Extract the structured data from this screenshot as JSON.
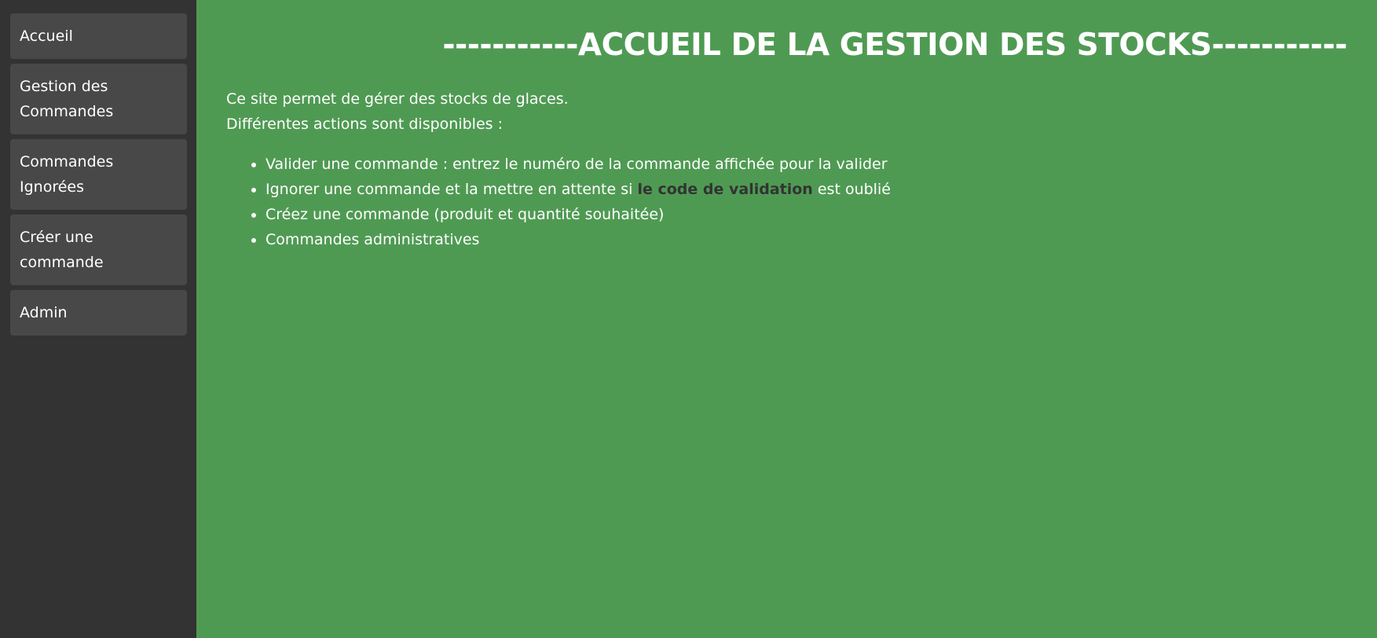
{
  "sidebar": {
    "items": [
      {
        "label": "Accueil"
      },
      {
        "label": "Gestion des",
        "label2": "Commandes"
      },
      {
        "label": "Commandes",
        "label2": "Ignorées"
      },
      {
        "label": "Créer une",
        "label2": "commande"
      },
      {
        "label": "Admin"
      }
    ]
  },
  "main": {
    "title": "-----------ACCUEIL DE LA GESTION DES STOCKS-----------",
    "intro_line1": "Ce site permet de gérer des stocks de glaces.",
    "intro_line2": "Différentes actions sont disponibles :",
    "actions": [
      "Valider une commande : entrez le numéro de la commande affichée pour la valider",
      {
        "before": "Ignorer une commande et la mettre en attente si ",
        "highlight": "le code de validation",
        "after": " est oublié"
      },
      "Créez une commande (produit et quantité souhaitée)",
      "Commandes administratives"
    ]
  },
  "colors": {
    "sidebar_bg": "#333333",
    "nav_item_bg": "#484848",
    "main_bg": "#4f9a53",
    "text": "#ffffff",
    "highlight_text": "#333333"
  }
}
